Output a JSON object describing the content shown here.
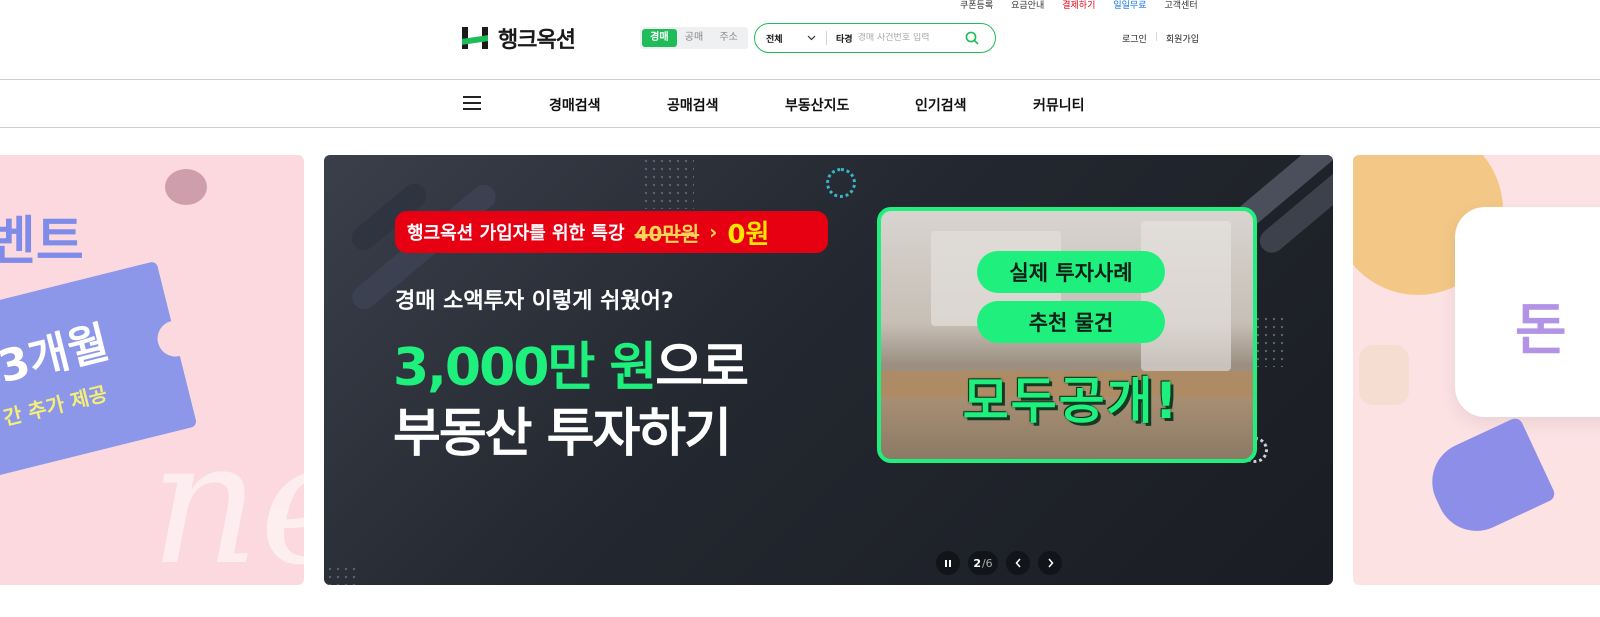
{
  "utility_links": [
    {
      "label": "쿠폰등록",
      "color": "#333333"
    },
    {
      "label": "요금안내",
      "color": "#333333"
    },
    {
      "label": "결제하기",
      "color": "#e60012"
    },
    {
      "label": "일일무료",
      "color": "#1a73e8"
    },
    {
      "label": "고객센터",
      "color": "#333333"
    }
  ],
  "logo": {
    "text": "행크옥션"
  },
  "search_mode": {
    "options": [
      "경매",
      "공매",
      "주소"
    ],
    "selected": "경매"
  },
  "search": {
    "scope": "전체",
    "tag": "타경",
    "placeholder": "경매 사건번호 입력",
    "icon": "search-icon"
  },
  "auth": {
    "login": "로그인",
    "signup": "회원가입"
  },
  "nav": {
    "menu_icon": "hamburger-icon",
    "items": [
      "경매검색",
      "공매검색",
      "부동산지도",
      "인기검색",
      "커뮤니티"
    ]
  },
  "banner": {
    "promo_label": "행크옥션 가입자를 위한 특강",
    "promo_old_price": "40만원",
    "promo_new_price": "0원",
    "subtitle": "경매 소액투자 이렇게 쉬웠어?",
    "headline_highlight": "3,000만 원",
    "headline_rest": "으로",
    "headline_line2": "부동산 투자하기",
    "badge1": "실제 투자사례",
    "badge2": "추천 물건",
    "reveal": "모두공개!"
  },
  "carousel": {
    "current": "2",
    "total": "/6",
    "pause_icon": "pause-icon",
    "prev_icon": "chevron-left-icon",
    "next_icon": "chevron-right-icon"
  },
  "side_slides": {
    "left_title": "벤트",
    "left_ticket": "3개월",
    "left_ticket_sub": "간 추가 제공",
    "left_script": "ne",
    "right_bubble": "돈"
  },
  "colors": {
    "accent": "#1fbd5a",
    "neon_green": "#1ff07d",
    "promo_red": "#e60012",
    "banner_bg": "#23272f"
  }
}
